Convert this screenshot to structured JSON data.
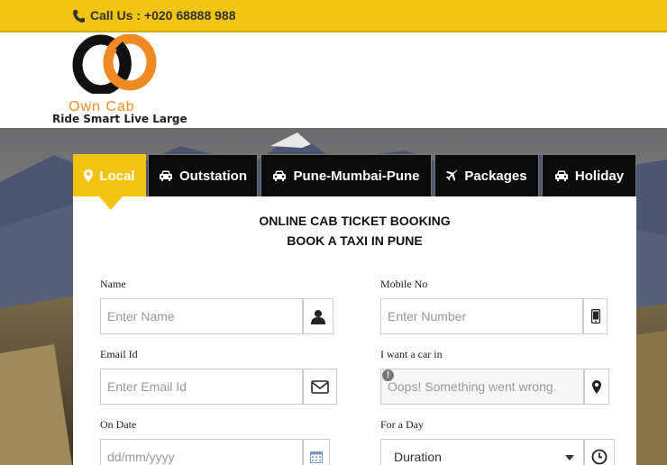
{
  "topbar": {
    "call_text": "Call Us : +020 68888 988",
    "bg_color": "#f1c40f"
  },
  "logo": {
    "brand": "Own Cab",
    "tagline": "Ride Smart Live Large",
    "brand_color": "#f08a24"
  },
  "tabs": [
    {
      "label": "Local",
      "icon": "map-marker-icon",
      "active": true
    },
    {
      "label": "Outstation",
      "icon": "car-icon",
      "active": false
    },
    {
      "label": "Pune-Mumbai-Pune",
      "icon": "car-icon",
      "active": false
    },
    {
      "label": "Packages",
      "icon": "plane-icon",
      "active": false
    },
    {
      "label": "Holiday",
      "icon": "car-icon",
      "active": false
    }
  ],
  "form": {
    "title_line1": "ONLINE CAB TICKET BOOKING",
    "title_line2": "BOOK A TAXI IN PUNE",
    "name": {
      "label": "Name",
      "placeholder": "Enter Name",
      "icon": "user-icon"
    },
    "mobile": {
      "label": "Mobile No",
      "placeholder": "Enter Number",
      "icon": "mobile-icon"
    },
    "email": {
      "label": "Email Id",
      "placeholder": "Enter Email Id",
      "icon": "envelope-icon"
    },
    "location": {
      "label": "I want a car in",
      "value": "Oops! Something went wrong.",
      "icon": "map-marker-icon",
      "error_badge": "!"
    },
    "date": {
      "label": "On Date",
      "placeholder": "dd/mm/yyyy",
      "icon": "calendar-icon"
    },
    "duration": {
      "label": "For a Day",
      "selected": "Duration",
      "icon": "clock-icon"
    }
  }
}
